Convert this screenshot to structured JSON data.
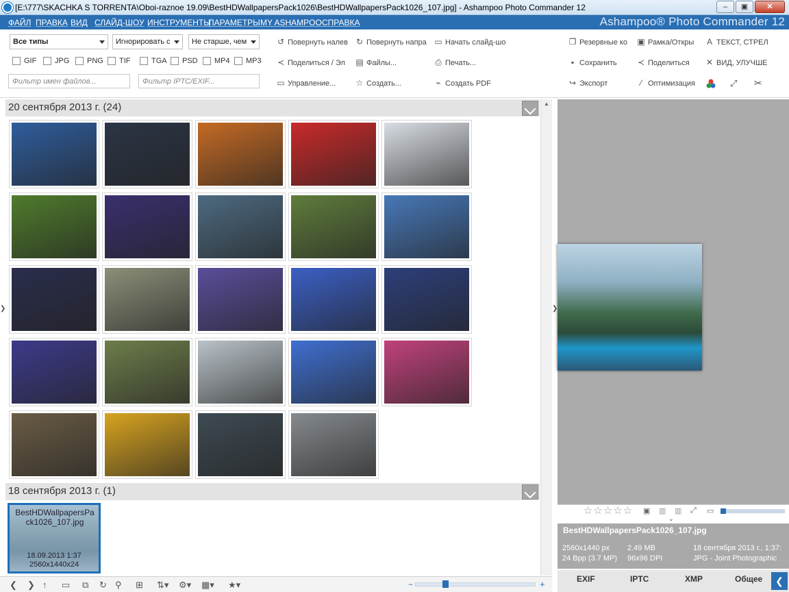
{
  "window": {
    "title": "[E:\\777\\SKACHKA S TORRENTA\\Oboi-raznoe 19.09\\BestHDWallpapersPack1026\\BestHDWallpapersPack1026_107.jpg] - Ashampoo Photo Commander 12",
    "minimize_label": "‒",
    "maximize_label": "▣",
    "close_label": "✕"
  },
  "menu": {
    "items": [
      "ФАЙЛ",
      "ПРАВКА",
      "ВИД",
      "СЛАЙД-ШОУ",
      "ИНСТРУМЕНТЫ",
      "ПАРАМЕТРЫ",
      "MY ASHAMPOO",
      "СПРАВКА"
    ],
    "brand": "Ashampoo® Photo Commander 12"
  },
  "filters": {
    "type_select": "Все типы",
    "ignore_select": "Игнорировать с",
    "age_select": "Не старше, чем",
    "types": [
      "GIF",
      "JPG",
      "PNG",
      "TIF",
      "TGA",
      "PSD",
      "MP4",
      "MP3"
    ],
    "filename_placeholder": "Фильтр имен файлов...",
    "iptc_placeholder": "Фильтр IPTC/EXIF..."
  },
  "toolbar_mid": {
    "rotate_left": "Повернуть налев",
    "rotate_right": "Повернуть напра",
    "slideshow": "Начать слайд-шо",
    "share": "Поделиться / Эл",
    "files": "Файлы...",
    "print": "Печать...",
    "manage": "Управление...",
    "create": "Создать...",
    "create_pdf": "Создать PDF"
  },
  "toolbar_right": {
    "backup": "Резервные ко",
    "frame": "Рамка/Откры",
    "text": "ТЕКСТ, СТРЕЛ",
    "save": "Сохранить",
    "share": "Поделиться",
    "view": "ВИД, УЛУЧШЕ",
    "export": "Экспорт",
    "optimize": "Оптимизация"
  },
  "groups": [
    {
      "label": "20 сентября 2013 г. (24)",
      "count": 24
    },
    {
      "label": "18 сентября 2013 г. (1)",
      "count": 1
    }
  ],
  "selected_thumb": {
    "name_line1": "BestHDWallpapersPa",
    "name_line2": "ck1026_107.jpg",
    "date": "18.09.2013 1:37",
    "dims": "2560x1440x24"
  },
  "thumbs": [
    "city-castle-night",
    "woman-cyborg",
    "autumn-road",
    "red-cups",
    "space-shuttle",
    "deer-grass",
    "night-skyline",
    "lighthouse-sea",
    "forest-river",
    "snow-mountains",
    "harbor-lights",
    "island-lake",
    "blue-pier",
    "white-cat",
    "canal-houses",
    "paris-night",
    "rabbits-grass",
    "oblivion-poster",
    "turbo-snails",
    "pink-beach",
    "tanks",
    "street-fighter",
    "vikings",
    "space-marine"
  ],
  "thumb_colors": [
    "#2f5d9c",
    "#2b3545",
    "#c46a24",
    "#c92a2a",
    "#d8dde3",
    "#4f7b2c",
    "#3a2f6e",
    "#4d6a80",
    "#5f7c3c",
    "#4778b8",
    "#2a2d4c",
    "#8b8f78",
    "#5b4d9a",
    "#3b5fc4",
    "#2d3f7a",
    "#3d3a8a",
    "#6d7d4a",
    "#b9c2c8",
    "#3f6fd0",
    "#c0427b",
    "#6a5c45",
    "#d7a320",
    "#3e4a52",
    "#858a8e"
  ],
  "info": {
    "filename": "BestHDWallpapersPack1026_107.jpg",
    "dims": "2560x1440 px",
    "size": "2.49 MB",
    "date": "18 сентября 2013 г., 1:37:",
    "bpp": "24 Bpp (3.7 MP)",
    "dpi": "96x96 DPI",
    "format": "JPG - Joint Photographic"
  },
  "tabs": [
    "EXIF",
    "IPTC",
    "XMP",
    "Общее"
  ],
  "rating_stars": "☆☆☆☆☆"
}
